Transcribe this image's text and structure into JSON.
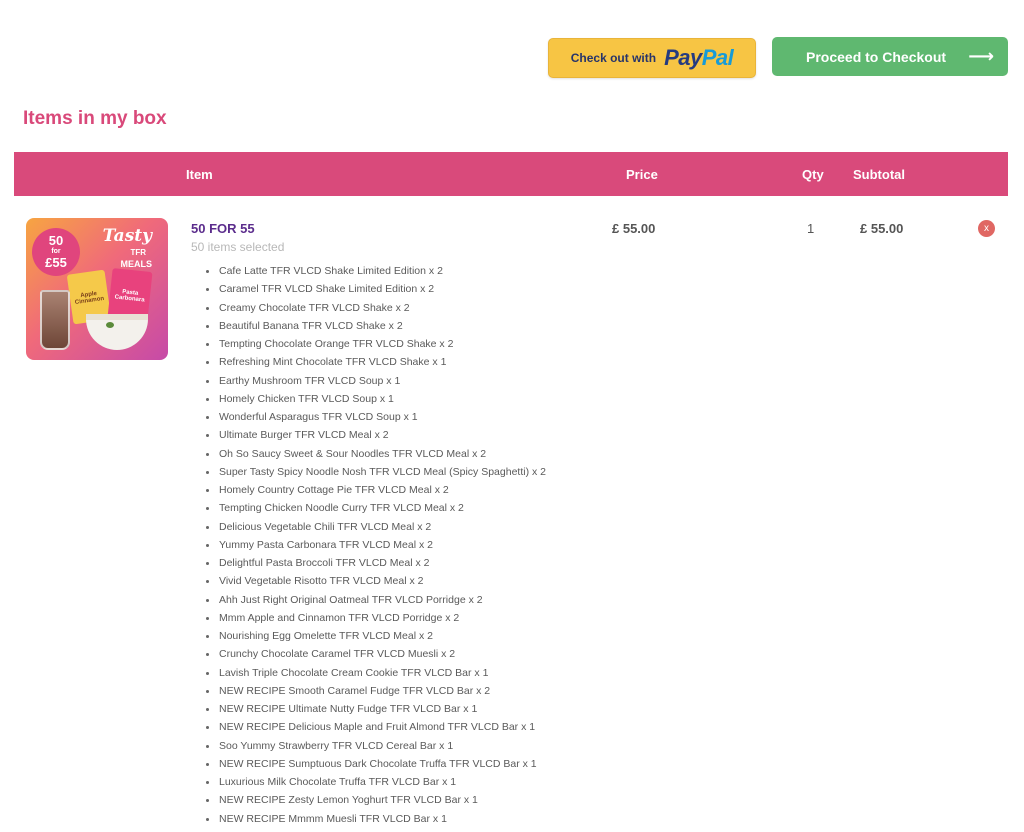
{
  "actions": {
    "paypal_prefix": "Check out with",
    "paypal_logo_pay": "Pay",
    "paypal_logo_pal": "Pal",
    "checkout_label": "Proceed to Checkout",
    "checkout_arrow": "⟶"
  },
  "section_title": "Items in my box",
  "table": {
    "headers": {
      "item": "Item",
      "price": "Price",
      "qty": "Qty",
      "subtotal": "Subtotal"
    }
  },
  "product": {
    "name": "50 FOR 55",
    "subtitle": "50 items selected",
    "price": "£ 55.00",
    "qty": "1",
    "subtotal": "£ 55.00",
    "remove_label": "x",
    "image": {
      "badge_line1": "50",
      "badge_line2": "for",
      "badge_line3": "£55",
      "tasty": "Tasty",
      "tfr": "TFR",
      "meals": "MEALS",
      "pack1_label": "Apple Cinnamon",
      "pack2_label": "Pasta Carbonara"
    },
    "items": [
      "Cafe Latte TFR VLCD Shake Limited Edition x 2",
      "Caramel TFR VLCD Shake Limited Edition x 2",
      "Creamy Chocolate TFR VLCD Shake x 2",
      "Beautiful Banana TFR VLCD Shake x 2",
      "Tempting Chocolate Orange TFR VLCD Shake x 2",
      "Refreshing Mint Chocolate TFR VLCD Shake x 1",
      "Earthy Mushroom TFR VLCD Soup x 1",
      "Homely Chicken TFR VLCD Soup x 1",
      "Wonderful Asparagus TFR VLCD Soup x 1",
      "Ultimate Burger TFR VLCD Meal x 2",
      "Oh So Saucy Sweet & Sour Noodles TFR VLCD Meal x 2",
      "Super Tasty Spicy Noodle Nosh TFR VLCD Meal (Spicy Spaghetti) x 2",
      "Homely Country Cottage Pie TFR VLCD Meal x 2",
      "Tempting Chicken Noodle Curry TFR VLCD Meal x 2",
      "Delicious Vegetable Chili TFR VLCD Meal x 2",
      "Yummy Pasta Carbonara TFR VLCD Meal x 2",
      "Delightful Pasta Broccoli TFR VLCD Meal x 2",
      "Vivid Vegetable Risotto TFR VLCD Meal x 2",
      "Ahh Just Right Original Oatmeal TFR VLCD Porridge x 2",
      "Mmm Apple and Cinnamon TFR VLCD Porridge x 2",
      "Nourishing Egg Omelette TFR VLCD Meal x 2",
      "Crunchy Chocolate Caramel TFR VLCD Muesli x 2",
      "Lavish Triple Chocolate Cream Cookie TFR VLCD Bar x 1",
      "NEW RECIPE Smooth Caramel Fudge TFR VLCD Bar x 2",
      "NEW RECIPE Ultimate Nutty Fudge TFR VLCD Bar x 1",
      "NEW RECIPE Delicious Maple and Fruit Almond TFR VLCD Bar x 1",
      "Soo Yummy Strawberry TFR VLCD Cereal Bar x 1",
      "NEW RECIPE Sumptuous Dark Chocolate Truffa TFR VLCD Bar x 1",
      "Luxurious Milk Chocolate Truffa TFR VLCD Bar x 1",
      "NEW RECIPE Zesty Lemon Yoghurt TFR VLCD Bar x 1",
      "NEW RECIPE Mmmm Muesli TFR VLCD Bar x 1"
    ]
  },
  "colors": {
    "accent_pink": "#d94a7b",
    "checkout_green": "#5fb870",
    "paypal_yellow": "#f7c544",
    "product_name_purple": "#5b2c8c",
    "remove_red": "#e06763"
  }
}
